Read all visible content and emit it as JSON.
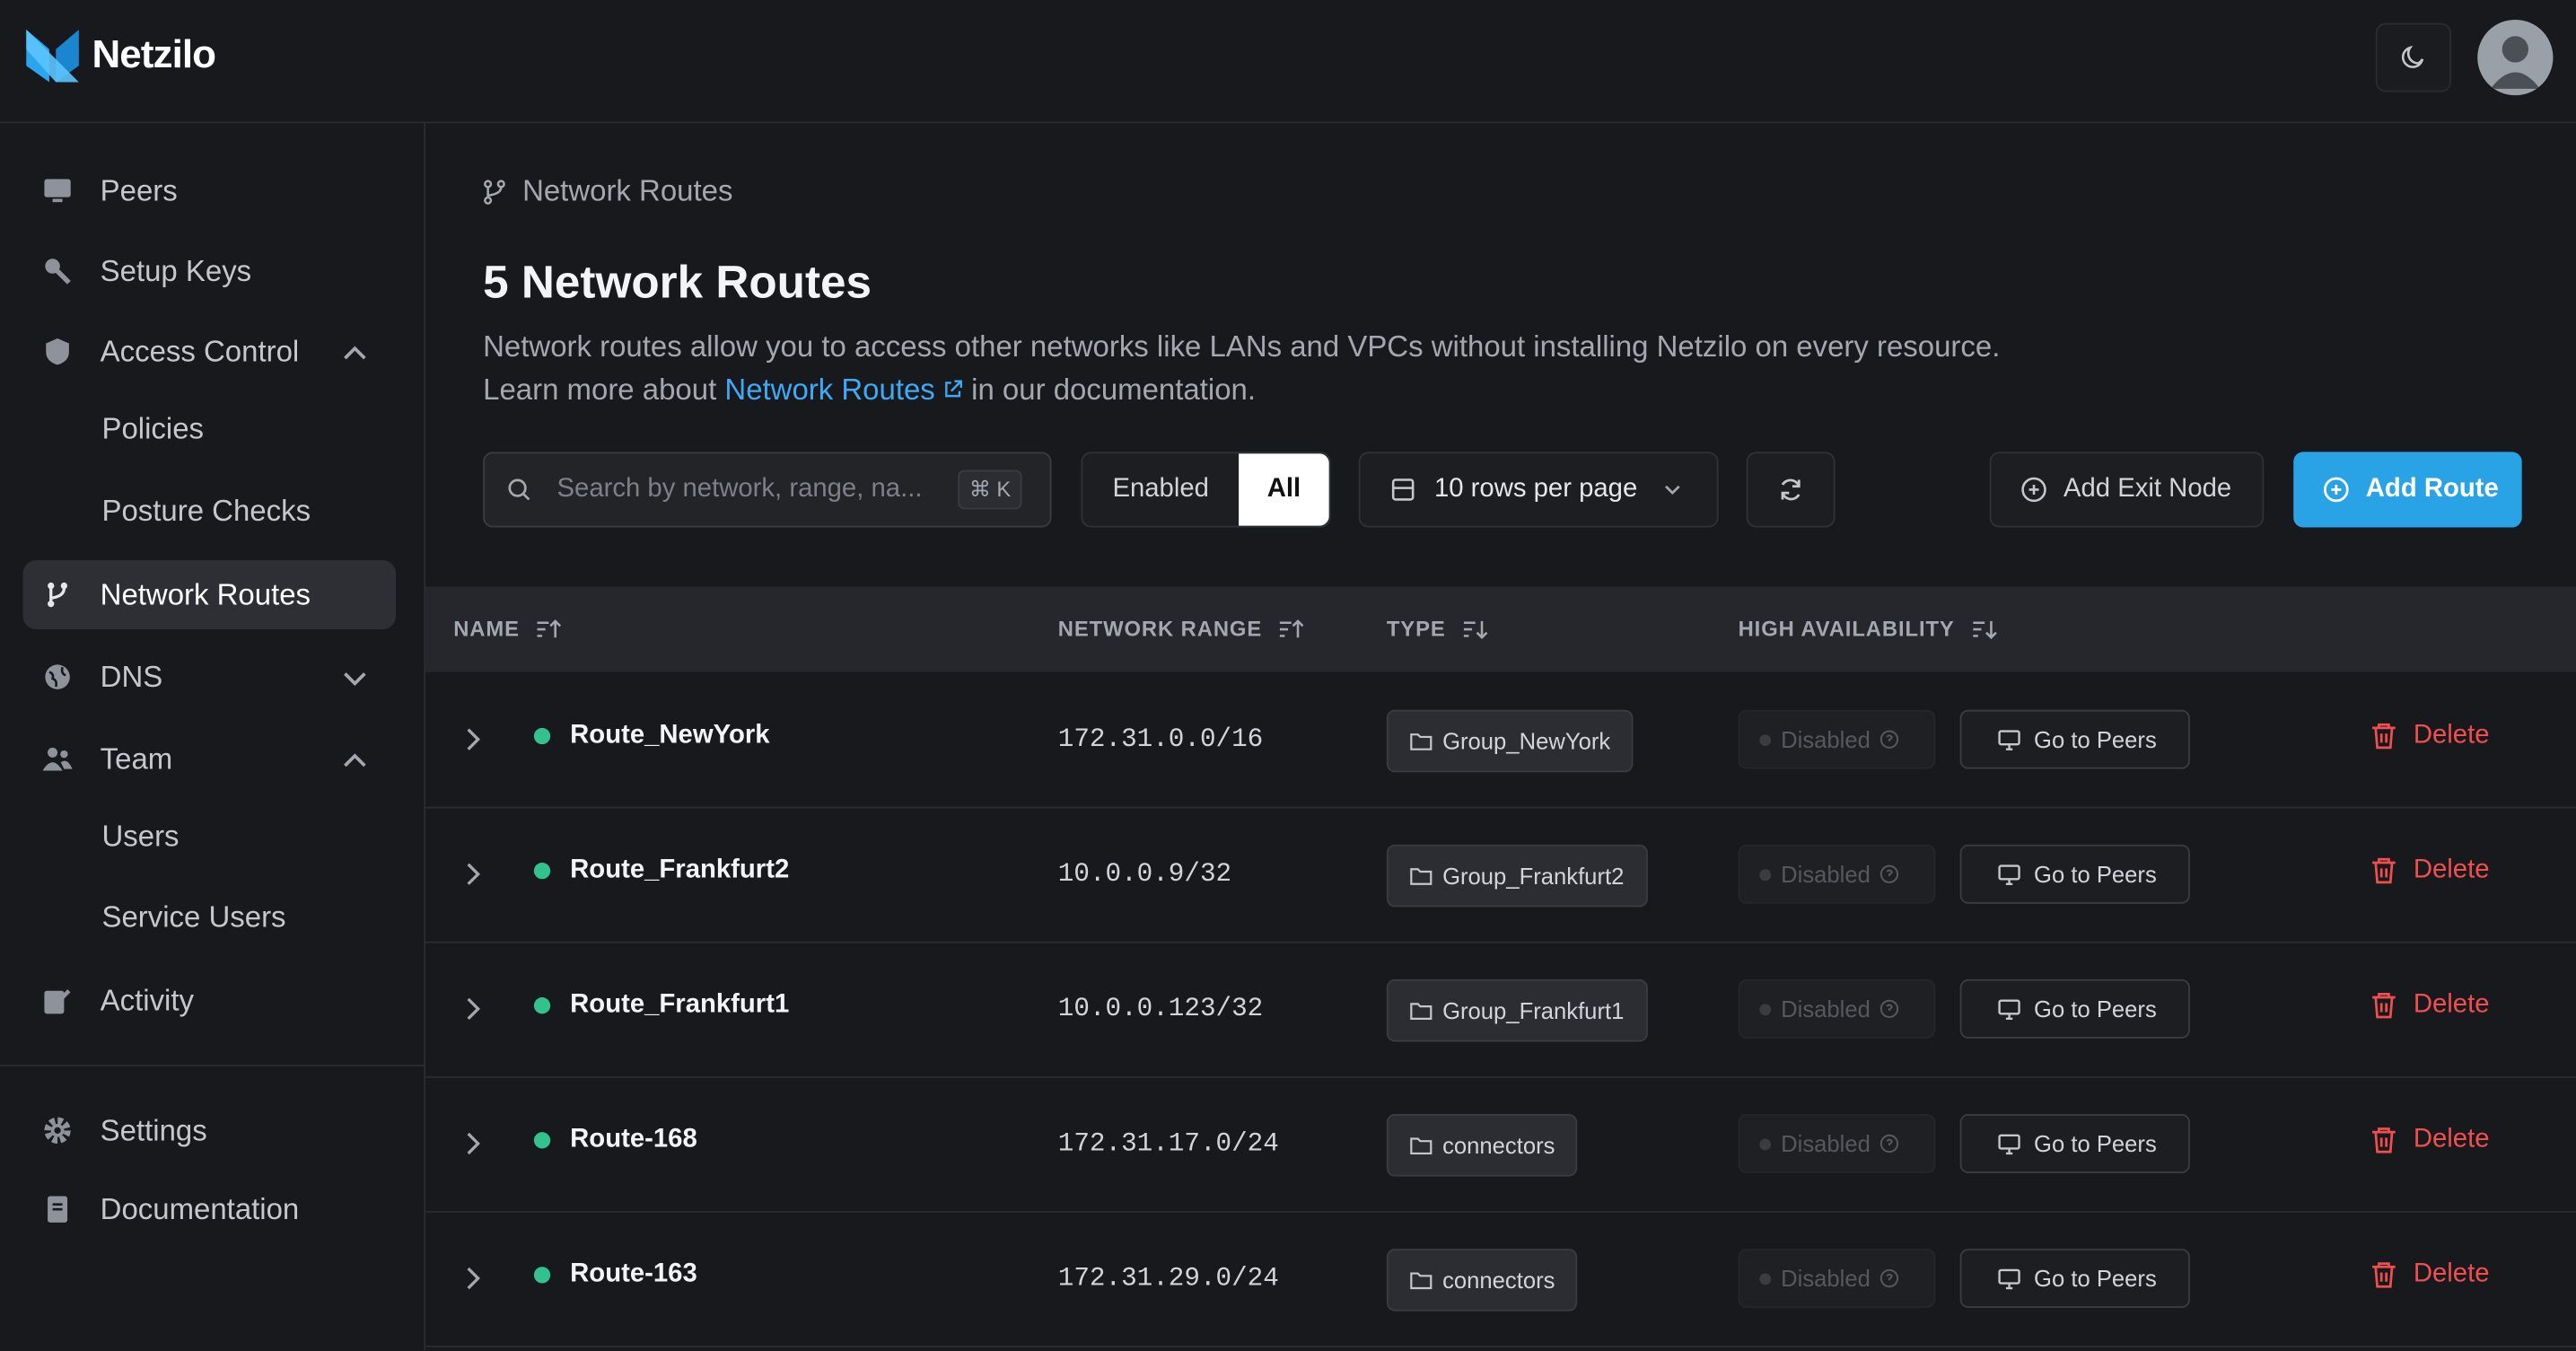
{
  "app": {
    "name": "Netzilo"
  },
  "sidebar": {
    "items": [
      {
        "label": "Peers"
      },
      {
        "label": "Setup Keys"
      },
      {
        "label": "Access Control"
      },
      {
        "label": "Policies"
      },
      {
        "label": "Posture Checks"
      },
      {
        "label": "Network Routes"
      },
      {
        "label": "DNS"
      },
      {
        "label": "Team"
      },
      {
        "label": "Users"
      },
      {
        "label": "Service Users"
      },
      {
        "label": "Activity"
      },
      {
        "label": "Settings"
      },
      {
        "label": "Documentation"
      }
    ]
  },
  "breadcrumb": {
    "label": "Network Routes"
  },
  "page": {
    "title": "5 Network Routes",
    "desc_line1": "Network routes allow you to access other networks like LANs and VPCs without installing Netzilo on every resource.",
    "desc_pre": "Learn more about",
    "desc_link": "Network Routes",
    "desc_post": "in our documentation."
  },
  "toolbar": {
    "search_placeholder": "Search by network, range, na...",
    "search_shortcut": "⌘ K",
    "filter_enabled": "Enabled",
    "filter_all": "All",
    "rows_per_page": "10 rows per page",
    "add_exit_node": "Add Exit Node",
    "add_route": "Add Route"
  },
  "table": {
    "headers": {
      "name": "NAME",
      "range": "NETWORK RANGE",
      "type": "TYPE",
      "ha": "HIGH AVAILABILITY"
    },
    "rows": [
      {
        "name": "Route_NewYork",
        "range": "172.31.0.0/16",
        "type": "Group_NewYork",
        "ha": "Disabled",
        "peers": "Go to Peers",
        "delete": "Delete"
      },
      {
        "name": "Route_Frankfurt2",
        "range": "10.0.0.9/32",
        "type": "Group_Frankfurt2",
        "ha": "Disabled",
        "peers": "Go to Peers",
        "delete": "Delete"
      },
      {
        "name": "Route_Frankfurt1",
        "range": "10.0.0.123/32",
        "type": "Group_Frankfurt1",
        "ha": "Disabled",
        "peers": "Go to Peers",
        "delete": "Delete"
      },
      {
        "name": "Route-168",
        "range": "172.31.17.0/24",
        "type": "connectors",
        "ha": "Disabled",
        "peers": "Go to Peers",
        "delete": "Delete"
      },
      {
        "name": "Route-163",
        "range": "172.31.29.0/24",
        "type": "connectors",
        "ha": "Disabled",
        "peers": "Go to Peers",
        "delete": "Delete"
      }
    ]
  },
  "colors": {
    "accent": "#29a3e6",
    "status_ok": "#32c28e",
    "danger": "#f04f4f",
    "background": "#18191d"
  }
}
